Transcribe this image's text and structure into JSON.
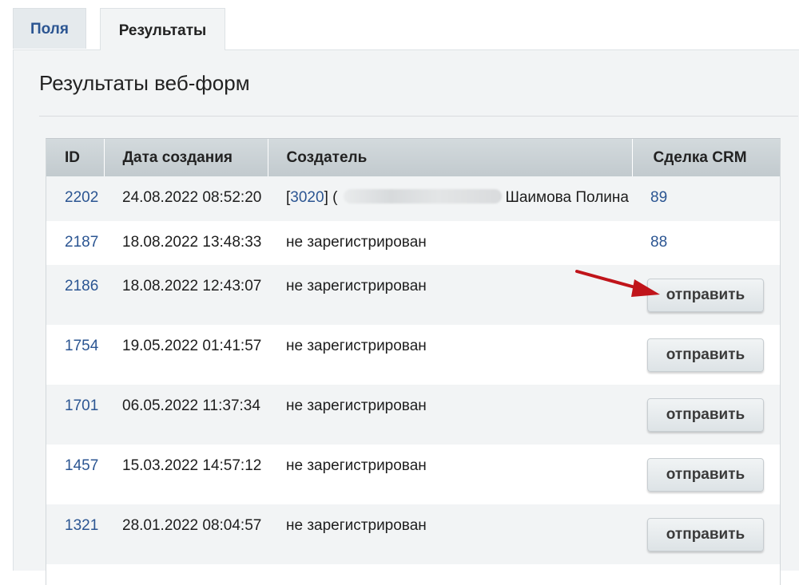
{
  "tabs": [
    {
      "label": "Поля"
    },
    {
      "label": "Результаты"
    }
  ],
  "page_title": "Результаты веб-форм",
  "table": {
    "headers": [
      "ID",
      "Дата создания",
      "Создатель",
      "Сделка CRM"
    ],
    "rows": [
      {
        "id": "2202",
        "date": "24.08.2022 08:52:20",
        "creator_prefix": "[",
        "creator_id": "3020",
        "creator_suffix": "] (",
        "creator_name": "Шаимова Полина",
        "crm": "89",
        "crm_type": "link"
      },
      {
        "id": "2187",
        "date": "18.08.2022 13:48:33",
        "creator": "не зарегистрирован",
        "crm": "88",
        "crm_type": "link"
      },
      {
        "id": "2186",
        "date": "18.08.2022 12:43:07",
        "creator": "не зарегистрирован",
        "crm": "отправить",
        "crm_type": "button"
      },
      {
        "id": "1754",
        "date": "19.05.2022 01:41:57",
        "creator": "не зарегистрирован",
        "crm": "отправить",
        "crm_type": "button"
      },
      {
        "id": "1701",
        "date": "06.05.2022 11:37:34",
        "creator": "не зарегистрирован",
        "crm": "отправить",
        "crm_type": "button"
      },
      {
        "id": "1457",
        "date": "15.03.2022 14:57:12",
        "creator": "не зарегистрирован",
        "crm": "отправить",
        "crm_type": "button"
      },
      {
        "id": "1321",
        "date": "28.01.2022 08:04:57",
        "creator": "не зарегистрирован",
        "crm": "отправить",
        "crm_type": "button"
      }
    ]
  },
  "colors": {
    "link": "#2b5592",
    "arrow": "#c0141a",
    "header_bg": "#c8d0d4",
    "panel_bg": "#f2f4f5"
  },
  "icons": {
    "annotation": "red-arrow-icon"
  }
}
